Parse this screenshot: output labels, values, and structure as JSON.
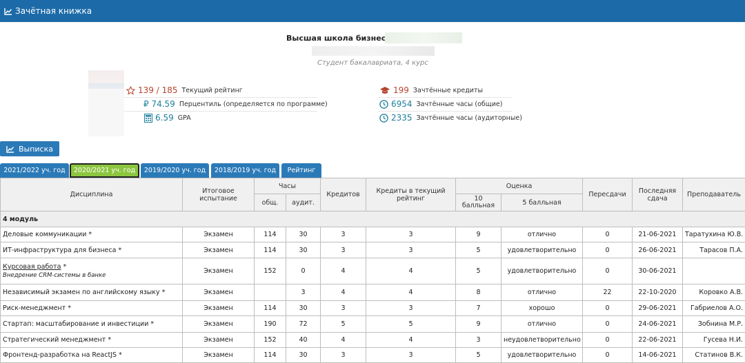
{
  "header": {
    "title": "Зачётная книжка",
    "icon": "chart-line-icon"
  },
  "profile": {
    "school": "Высшая школа бизнеса :",
    "student": "Студент бакалавриата, 4 курс"
  },
  "stats_left": [
    {
      "icon": "star-icon",
      "value": "139 / 185",
      "label": "Текущий рейтинг",
      "color": "#b5442d"
    },
    {
      "icon": "ruble-icon",
      "value": "₽ 74.59",
      "label": "Перцентиль (определяется по программе)",
      "color": "#1c7f9a"
    },
    {
      "icon": "calculator-icon",
      "value": "6.59",
      "label": "GPA",
      "color": "#1c7f9a"
    }
  ],
  "stats_right": [
    {
      "icon": "graduation-cap-icon",
      "value": "199",
      "label": "Зачтённые кредиты",
      "color": "#b5442d"
    },
    {
      "icon": "clock-icon",
      "value": "6954",
      "label": "Зачтённые часы (общие)",
      "color": "#1c7f9a"
    },
    {
      "icon": "clock-icon",
      "value": "2335",
      "label": "Зачтённые часы (аудиторные)",
      "color": "#1c7f9a"
    }
  ],
  "extract_button": "Выписка",
  "tabs": [
    {
      "label": "2021/2022 уч. год",
      "active": false
    },
    {
      "label": "2020/2021 уч. год",
      "active": true
    },
    {
      "label": "2019/2020 уч. год",
      "active": false
    },
    {
      "label": "2018/2019 уч. год",
      "active": false
    },
    {
      "label": "Рейтинг",
      "active": false
    }
  ],
  "table": {
    "headers": {
      "discipline": "Дисциплина",
      "final_test": "Итоговое испытание",
      "hours": "Часы",
      "hours_total": "общ.",
      "hours_aud": "аудит.",
      "credits": "Кредитов",
      "credits_rating": "Кредиты в текущий рейтинг",
      "grade": "Оценка",
      "grade10": "10 балльная",
      "grade5": "5 балльная",
      "retakes": "Пересдачи",
      "last_date": "Последняя сдача",
      "teacher": "Преподаватель"
    },
    "module": "4 модуль",
    "rows": [
      {
        "discipline": "Деловые коммуникации *",
        "test": "Экзамен",
        "total": "114",
        "aud": "30",
        "credits": "3",
        "rating": "3",
        "g10": "9",
        "g5": "отлично",
        "retakes": "0",
        "date": "21-06-2021",
        "teacher": "Таратухина Ю.В."
      },
      {
        "discipline": "ИТ-инфраструктура для бизнеса *",
        "test": "Экзамен",
        "total": "114",
        "aud": "30",
        "credits": "3",
        "rating": "3",
        "g10": "5",
        "g5": "удовлетворительно",
        "retakes": "0",
        "date": "26-06-2021",
        "teacher": "Тарасов П.А."
      },
      {
        "discipline": "Курсовая работа",
        "discipline_suffix": " *",
        "sub": "Внедрение CRM-системы в банке",
        "link": true,
        "test": "Экзамен",
        "total": "152",
        "aud": "0",
        "credits": "4",
        "rating": "4",
        "g10": "5",
        "g5": "удовлетворительно",
        "retakes": "0",
        "date": "30-06-2021",
        "teacher": ""
      },
      {
        "discipline": "Независимый экзамен по английскому языку *",
        "test": "Экзамен",
        "total": "",
        "aud": "3",
        "credits": "4",
        "rating": "4",
        "g10": "8",
        "g5": "отлично",
        "retakes": "22",
        "date": "22-10-2020",
        "teacher": "Коровко А.В."
      },
      {
        "discipline": "Риск-менеджмент *",
        "test": "Экзамен",
        "total": "114",
        "aud": "30",
        "credits": "3",
        "rating": "3",
        "g10": "7",
        "g5": "хорошо",
        "retakes": "0",
        "date": "29-06-2021",
        "teacher": "Габриелов А.О."
      },
      {
        "discipline": "Стартап: масштабирование и инвестиции *",
        "test": "Экзамен",
        "total": "190",
        "aud": "72",
        "credits": "5",
        "rating": "5",
        "g10": "9",
        "g5": "отлично",
        "retakes": "0",
        "date": "24-06-2021",
        "teacher": "Зобнина М.Р."
      },
      {
        "discipline": "Стратегический менеджмент *",
        "test": "Экзамен",
        "total": "152",
        "aud": "40",
        "credits": "4",
        "rating": "4",
        "g10": "3",
        "g5": "неудовлетворительно",
        "retakes": "0",
        "date": "22-06-2021",
        "teacher": "Гусева Н.И."
      },
      {
        "discipline": "Фронтенд-разработка на ReactJS *",
        "test": "Экзамен",
        "total": "114",
        "aud": "30",
        "credits": "3",
        "rating": "3",
        "g10": "5",
        "g5": "удовлетворительно",
        "retakes": "0",
        "date": "14-06-2021",
        "teacher": "Статинов В.К."
      }
    ]
  }
}
